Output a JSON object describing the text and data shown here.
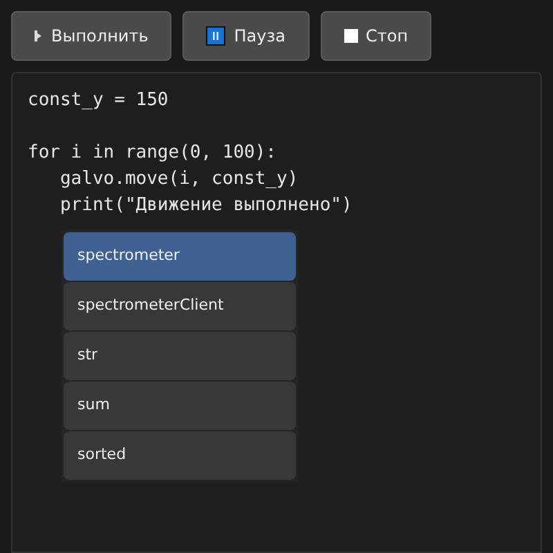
{
  "toolbar": [
    {
      "kind": "run",
      "label": "Выполнить"
    },
    {
      "kind": "pause",
      "label": "Пауза"
    },
    {
      "kind": "stop",
      "label": "Стоп"
    }
  ],
  "editor": {
    "lines": [
      {
        "text": "const_y = 150",
        "blank_before": false
      },
      {
        "text": "for i in range(0, 100):",
        "blank_before": true
      },
      {
        "text": "   galvo.move(i, const_y)",
        "blank_before": false
      },
      {
        "text": "   print(\"Движение выполнено\")",
        "blank_before": false
      }
    ]
  },
  "autocomplete": [
    {
      "label": "spectrometer",
      "selected": true
    },
    {
      "label": "spectrometerClient",
      "selected": false
    },
    {
      "label": "str",
      "selected": false
    },
    {
      "label": "sum",
      "selected": false
    },
    {
      "label": "sorted",
      "selected": false
    }
  ]
}
